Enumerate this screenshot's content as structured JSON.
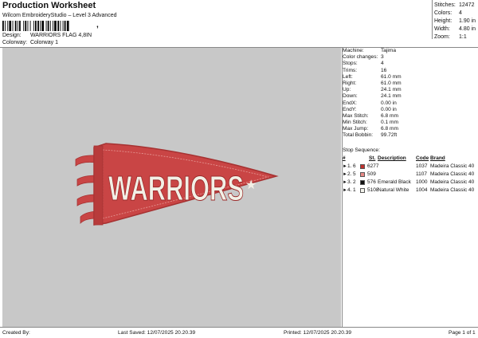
{
  "header": {
    "title": "Production Worksheet",
    "subtitle": "Wilcom EmbroideryStudio – Level 3 Advanced",
    "barcode_suffix": ","
  },
  "design": {
    "label": "Design:",
    "value": "WARRIORS FLAG 4,8IN"
  },
  "colorway": {
    "label": "Colorway:",
    "value": "Colorway 1"
  },
  "stats": [
    {
      "k": "Stitches:",
      "v": "12472"
    },
    {
      "k": "Colors:",
      "v": "4"
    },
    {
      "k": "Height:",
      "v": "1.90 in"
    },
    {
      "k": "Width:",
      "v": "4.80 in"
    },
    {
      "k": "Zoom:",
      "v": "1:1"
    }
  ],
  "properties": [
    {
      "k": "Machine:",
      "v": "Tajima"
    },
    {
      "k": "Color changes:",
      "v": "3"
    },
    {
      "k": "Stops:",
      "v": "4"
    },
    {
      "k": "Trims:",
      "v": "16"
    },
    {
      "k": "Left:",
      "v": "61.0 mm"
    },
    {
      "k": "Right:",
      "v": "61.0 mm"
    },
    {
      "k": "Up:",
      "v": "24.1 mm"
    },
    {
      "k": "Down:",
      "v": "24.1 mm"
    },
    {
      "k": "EndX:",
      "v": "0.00 in"
    },
    {
      "k": "EndY:",
      "v": "0.00 in"
    },
    {
      "k": "Max Stitch:",
      "v": "6.8 mm"
    },
    {
      "k": "Min Stitch:",
      "v": "0.1 mm"
    },
    {
      "k": "Max Jump:",
      "v": "6.8 mm"
    },
    {
      "k": "Total Bobbin:",
      "v": "99.72ft"
    }
  ],
  "stop_sequence": {
    "label": "Stop Sequence:",
    "headers": {
      "n": "#",
      "st": "St.",
      "description": "Description",
      "code": "Code",
      "brand": "Brand"
    },
    "rows": [
      {
        "a": "1.",
        "b": "6",
        "color": "#c0312e",
        "st": "6277",
        "description": "",
        "code": "1037",
        "brand": "Madeira Classic 40"
      },
      {
        "a": "2.",
        "b": "5",
        "color": "#e88a86",
        "st": "509",
        "description": "",
        "code": "1107",
        "brand": "Madeira Classic 40"
      },
      {
        "a": "3.",
        "b": "2",
        "color": "#111111",
        "st": "576",
        "description": "Emerald Black",
        "code": "1000",
        "brand": "Madeira Classic 40"
      },
      {
        "a": "4.",
        "b": "1",
        "color": "#f4f4ec",
        "st": "5108",
        "description": "Natural White",
        "code": "1004",
        "brand": "Madeira Classic 40"
      }
    ]
  },
  "artwork": {
    "text": "WARRIORS",
    "star": "★"
  },
  "colors": {
    "pennant": "#c94545",
    "pennant_dark": "#a63232",
    "letters": "#f2f0e6",
    "canvas": "#c8c8c8"
  },
  "footer": {
    "created_by": "Created By:",
    "last_saved": "Last Saved: 12/07/2025 20.20.39",
    "printed": "Printed: 12/07/2025 20.20.39",
    "page": "Page 1 of 1"
  }
}
